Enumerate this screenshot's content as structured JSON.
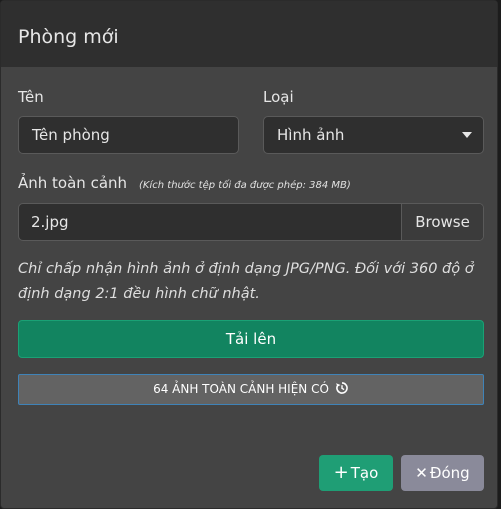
{
  "modal": {
    "title": "Phòng mới"
  },
  "form": {
    "name_label": "Tên",
    "name_value": "Tên phòng",
    "type_label": "Loại",
    "type_value": "Hình ảnh",
    "panorama_label": "Ảnh toàn cảnh",
    "panorama_hint": "(Kích thước tệp tối đa được phép: 384 MB)",
    "file_name": "2.jpg",
    "browse_label": "Browse",
    "note": "Chỉ chấp nhận hình ảnh ở định dạng JPG/PNG. Đối với 360 độ ở định dạng 2:1 đều hình chữ nhật.",
    "upload_label": "Tải lên",
    "existing_label": "64 ẢNH TOÀN CẢNH HIỆN CÓ"
  },
  "footer": {
    "create_label": "Tạo",
    "close_label": "Đóng"
  },
  "icons": {
    "create": "plus-icon",
    "close": "x-icon",
    "existing": "history-icon",
    "type_select": "caret-down-icon"
  },
  "colors": {
    "upload_button": "#128460",
    "create_button": "#1f9e75",
    "close_button": "#8a8a9a",
    "modal_background": "#444444",
    "header_background": "#2f2f2f"
  }
}
